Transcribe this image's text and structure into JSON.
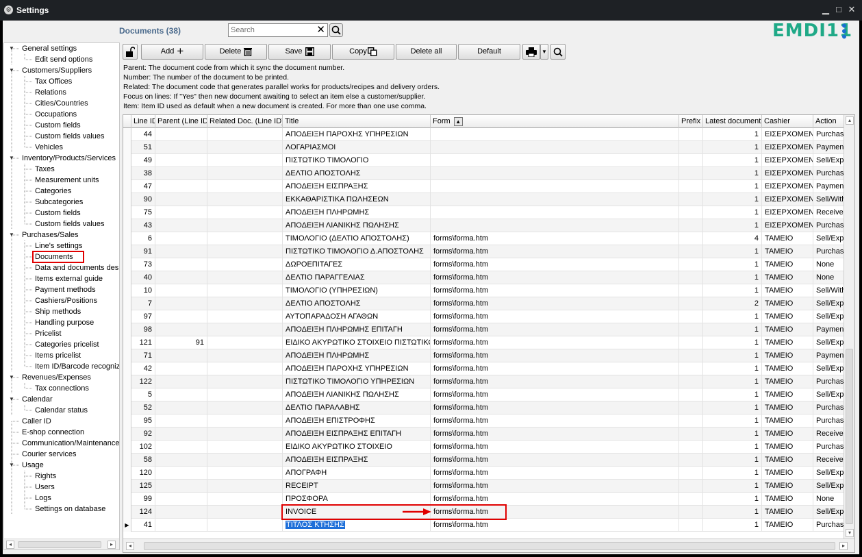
{
  "window": {
    "title": "Settings"
  },
  "header": {
    "title": "Documents (38)",
    "logo": "EMDI11"
  },
  "search": {
    "placeholder": "Search"
  },
  "toolbar": {
    "add": "Add",
    "delete": "Delete",
    "save": "Save",
    "copy": "Copy",
    "delete_all": "Delete all",
    "default": "Default"
  },
  "notes": [
    "Parent: The document code from which it sync the document number.",
    "Number: The number of the document to be printed.",
    "Related: The document code that generates parallel works for products/recipes and delivery orders.",
    "Focus on lines: If \"Yes\" then new document awaiting to select an item else a customer/supplier.",
    "Item: Item ID used as default when a new document is created. For more than one use comma."
  ],
  "sidebar": {
    "items": [
      {
        "label": "General settings",
        "level": 0,
        "expanded": true
      },
      {
        "label": "Edit send options",
        "level": 1
      },
      {
        "label": "Customers/Suppliers",
        "level": 0,
        "expanded": true
      },
      {
        "label": "Tax Offices",
        "level": 1
      },
      {
        "label": "Relations",
        "level": 1
      },
      {
        "label": "Cities/Countries",
        "level": 1
      },
      {
        "label": "Occupations",
        "level": 1
      },
      {
        "label": "Custom fields",
        "level": 1
      },
      {
        "label": "Custom fields values",
        "level": 1
      },
      {
        "label": "Vehicles",
        "level": 1
      },
      {
        "label": "Inventory/Products/Services",
        "level": 0,
        "expanded": true
      },
      {
        "label": "Taxes",
        "level": 1
      },
      {
        "label": "Measurement units",
        "level": 1
      },
      {
        "label": "Categories",
        "level": 1
      },
      {
        "label": "Subcategories",
        "level": 1
      },
      {
        "label": "Custom fields",
        "level": 1
      },
      {
        "label": "Custom fields values",
        "level": 1
      },
      {
        "label": "Purchases/Sales",
        "level": 0,
        "expanded": true
      },
      {
        "label": "Line's settings",
        "level": 1
      },
      {
        "label": "Documents",
        "level": 1,
        "selected": true
      },
      {
        "label": "Data and documents desi",
        "level": 1
      },
      {
        "label": "Items external guide",
        "level": 1
      },
      {
        "label": "Payment methods",
        "level": 1
      },
      {
        "label": "Cashiers/Positions",
        "level": 1
      },
      {
        "label": "Ship methods",
        "level": 1
      },
      {
        "label": "Handling purpose",
        "level": 1
      },
      {
        "label": "Pricelist",
        "level": 1
      },
      {
        "label": "Categories pricelist",
        "level": 1
      },
      {
        "label": "Items pricelist",
        "level": 1
      },
      {
        "label": "Item ID/Barcode recognize",
        "level": 1
      },
      {
        "label": "Revenues/Expenses",
        "level": 0,
        "expanded": true
      },
      {
        "label": "Tax connections",
        "level": 1
      },
      {
        "label": "Calendar",
        "level": 0,
        "expanded": true
      },
      {
        "label": "Calendar status",
        "level": 1
      },
      {
        "label": "Caller ID",
        "level": 0
      },
      {
        "label": "E-shop connection",
        "level": 0
      },
      {
        "label": "Communication/Maintenance",
        "level": 0
      },
      {
        "label": "Courier services",
        "level": 0
      },
      {
        "label": "Usage",
        "level": 0,
        "expanded": true
      },
      {
        "label": "Rights",
        "level": 1
      },
      {
        "label": "Users",
        "level": 1
      },
      {
        "label": "Logs",
        "level": 1
      },
      {
        "label": "Settings on database",
        "level": 1
      }
    ]
  },
  "grid": {
    "columns": [
      "Line ID",
      "Parent (Line ID)",
      "Related Doc. (Line ID)",
      "Title",
      "Form",
      "Prefix",
      "Latest document",
      "Cashier",
      "Action"
    ],
    "rows": [
      [
        "44",
        "",
        "",
        "ΑΠΟΔΕΙΞΗ ΠΑΡΟΧΗΣ ΥΠΗΡΕΣΙΩΝ",
        "",
        "",
        "1",
        "ΕΙΣΕΡΧΟΜΕΝΑ",
        "Purchas"
      ],
      [
        "51",
        "",
        "",
        "ΛΟΓΑΡΙΑΣΜΟΙ",
        "",
        "",
        "1",
        "ΕΙΣΕΡΧΟΜΕΝΑ",
        "Paymen"
      ],
      [
        "49",
        "",
        "",
        "ΠΙΣΤΩΤΙΚΟ ΤΙΜΟΛΟΓΙΟ",
        "",
        "",
        "1",
        "ΕΙΣΕΡΧΟΜΕΝΑ",
        "Sell/Exp"
      ],
      [
        "38",
        "",
        "",
        "ΔΕΛΤΙΟ ΑΠΟΣΤΟΛΗΣ",
        "",
        "",
        "1",
        "ΕΙΣΕΡΧΟΜΕΝΑ",
        "Purchas"
      ],
      [
        "47",
        "",
        "",
        "ΑΠΟΔΕΙΞΗ ΕΙΣΠΡΑΞΗΣ",
        "",
        "",
        "1",
        "ΕΙΣΕΡΧΟΜΕΝΑ",
        "Paymen"
      ],
      [
        "90",
        "",
        "",
        "ΕΚΚΑΘΑΡΙΣΤΙΚΑ ΠΩΛΗΣΕΩΝ",
        "",
        "",
        "1",
        "ΕΙΣΕΡΧΟΜΕΝΑ",
        "Sell/With"
      ],
      [
        "75",
        "",
        "",
        "ΑΠΟΔΕΙΞΗ ΠΛΗΡΩΜΗΣ",
        "",
        "",
        "1",
        "ΕΙΣΕΡΧΟΜΕΝΑ",
        "Receive"
      ],
      [
        "43",
        "",
        "",
        "ΑΠΟΔΕΙΞΗ ΛΙΑΝΙΚΗΣ ΠΩΛΗΣΗΣ",
        "",
        "",
        "1",
        "ΕΙΣΕΡΧΟΜΕΝΑ",
        "Purchas"
      ],
      [
        "6",
        "",
        "",
        "ΤΙΜΟΛΟΓΙΟ (ΔΕΛΤΙΟ ΑΠΟΣΤΟΛΗΣ)",
        "forms\\forma.htm",
        "",
        "4",
        "ΤΑΜΕΙΟ",
        "Sell/Exp"
      ],
      [
        "91",
        "",
        "",
        "ΠΙΣΤΩΤΙΚΟ ΤΙΜΟΛΟΓΙΟ Δ.ΑΠΟΣΤΟΛΗΣ",
        "forms\\forma.htm",
        "",
        "1",
        "ΤΑΜΕΙΟ",
        "Purchas"
      ],
      [
        "73",
        "",
        "",
        "ΔΩΡΟΕΠΙΤΑΓΕΣ",
        "forms\\forma.htm",
        "",
        "1",
        "ΤΑΜΕΙΟ",
        "None"
      ],
      [
        "40",
        "",
        "",
        "ΔΕΛΤΙΟ ΠΑΡΑΓΓΕΛΙΑΣ",
        "forms\\forma.htm",
        "",
        "1",
        "ΤΑΜΕΙΟ",
        "None"
      ],
      [
        "10",
        "",
        "",
        "ΤΙΜΟΛΟΓΙΟ (ΥΠΗΡΕΣΙΩΝ)",
        "forms\\forma.htm",
        "",
        "1",
        "ΤΑΜΕΙΟ",
        "Sell/With"
      ],
      [
        "7",
        "",
        "",
        "ΔΕΛΤΙΟ ΑΠΟΣΤΟΛΗΣ",
        "forms\\forma.htm",
        "",
        "2",
        "ΤΑΜΕΙΟ",
        "Sell/Exp"
      ],
      [
        "97",
        "",
        "",
        "ΑΥΤΟΠΑΡΑΔΟΣΗ ΑΓΑΘΩΝ",
        "forms\\forma.htm",
        "",
        "1",
        "ΤΑΜΕΙΟ",
        "Sell/Exp"
      ],
      [
        "98",
        "",
        "",
        "ΑΠΟΔΕΙΞΗ ΠΛΗΡΩΜΗΣ ΕΠΙΤΑΓΗ",
        "forms\\forma.htm",
        "",
        "1",
        "ΤΑΜΕΙΟ",
        "Paymen"
      ],
      [
        "121",
        "91",
        "",
        "ΕΙΔΙΚΟ ΑΚΥΡΩΤΙΚΟ ΣΤΟΙΧΕΙΟ ΠΙΣΤΩΤΙΚΟ",
        "forms\\forma.htm",
        "",
        "1",
        "ΤΑΜΕΙΟ",
        "Sell/Exp"
      ],
      [
        "71",
        "",
        "",
        "ΑΠΟΔΕΙΞΗ ΠΛΗΡΩΜΗΣ",
        "forms\\forma.htm",
        "",
        "1",
        "ΤΑΜΕΙΟ",
        "Paymen"
      ],
      [
        "42",
        "",
        "",
        "ΑΠΟΔΕΙΞΗ ΠΑΡΟΧΗΣ ΥΠΗΡΕΣΙΩΝ",
        "forms\\forma.htm",
        "",
        "1",
        "ΤΑΜΕΙΟ",
        "Sell/Exp"
      ],
      [
        "122",
        "",
        "",
        "ΠΙΣΤΩΤΙΚΟ ΤΙΜΟΛΟΓΙΟ ΥΠΗΡΕΣΙΩΝ",
        "forms\\forma.htm",
        "",
        "1",
        "ΤΑΜΕΙΟ",
        "Purchas"
      ],
      [
        "5",
        "",
        "",
        "ΑΠΟΔΕΙΞΗ ΛΙΑΝΙΚΗΣ ΠΩΛΗΣΗΣ",
        "forms\\forma.htm",
        "",
        "1",
        "ΤΑΜΕΙΟ",
        "Sell/Exp"
      ],
      [
        "52",
        "",
        "",
        "ΔΕΛΤΙΟ ΠΑΡΑΛΑΒΗΣ",
        "forms\\forma.htm",
        "",
        "1",
        "ΤΑΜΕΙΟ",
        "Purchas"
      ],
      [
        "95",
        "",
        "",
        "ΑΠΟΔΕΙΞΗ ΕΠΙΣΤΡΟΦΗΣ",
        "forms\\forma.htm",
        "",
        "1",
        "ΤΑΜΕΙΟ",
        "Purchas"
      ],
      [
        "92",
        "",
        "",
        "ΑΠΟΔΕΙΞΗ ΕΙΣΠΡΑΞΗΣ ΕΠΙΤΑΓΗ",
        "forms\\forma.htm",
        "",
        "1",
        "ΤΑΜΕΙΟ",
        "Receive"
      ],
      [
        "102",
        "",
        "",
        "ΕΙΔΙΚΟ ΑΚΥΡΩΤΙΚΟ ΣΤΟΙΧΕΙΟ",
        "forms\\forma.htm",
        "",
        "1",
        "ΤΑΜΕΙΟ",
        "Purchas"
      ],
      [
        "58",
        "",
        "",
        "ΑΠΟΔΕΙΞΗ ΕΙΣΠΡΑΞΗΣ",
        "forms\\forma.htm",
        "",
        "1",
        "ΤΑΜΕΙΟ",
        "Receive"
      ],
      [
        "120",
        "",
        "",
        "ΑΠΟΓΡΑΦΗ",
        "forms\\forma.htm",
        "",
        "1",
        "ΤΑΜΕΙΟ",
        "Sell/Exp"
      ],
      [
        "125",
        "",
        "",
        "RECEIPT",
        "forms\\forma.htm",
        "",
        "1",
        "ΤΑΜΕΙΟ",
        "Sell/Exp"
      ],
      [
        "99",
        "",
        "",
        "ΠΡΟΣΦΟΡΑ",
        "forms\\forma.htm",
        "",
        "1",
        "ΤΑΜΕΙΟ",
        "None"
      ],
      [
        "124",
        "",
        "",
        "INVOICE",
        "forms\\forma.htm",
        "",
        "1",
        "ΤΑΜΕΙΟ",
        "Sell/Exp"
      ],
      [
        "41",
        "",
        "",
        "ΤΙΤΛΟΣ ΚΤΗΣΗΣ",
        "forms\\forma.htm",
        "",
        "1",
        "ΤΑΜΕΙΟ",
        "Purchas"
      ]
    ],
    "current_row": 30,
    "highlight_row": 29
  },
  "colors": {
    "accent": "#1fa987",
    "header_title": "#4a6a8c",
    "highlight": "#e00000",
    "selection": "#1e6fd9"
  }
}
